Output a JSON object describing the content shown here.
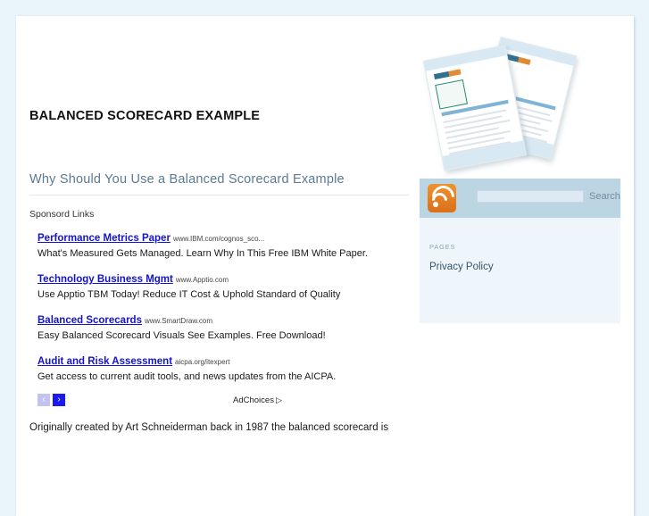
{
  "site": {
    "title": "BALANCED SCORECARD EXAMPLE"
  },
  "colors": {
    "page_background": "#eaf4fb",
    "card_background": "#ffffff",
    "heading": "#5c7a93",
    "ad_link": "#1414cc",
    "sidebar_header": "#bcd5e2",
    "sidebar_body": "#eef6fb",
    "rss_orange": "#e08a33",
    "pager_active": "#1a1aee",
    "pager_disabled": "#c3c3f0"
  },
  "header": {
    "art_name": "documents-illustration"
  },
  "main": {
    "post_title": "Why Should You Use a Balanced Scorecard Example",
    "ads": {
      "label": "Sponsord Links",
      "items": [
        {
          "headline": "Performance Metrics Paper",
          "url": "www.IBM.com/cognos_sco...",
          "description": "What's Measured Gets Managed. Learn Why In This Free IBM White Paper."
        },
        {
          "headline": "Technology Business Mgmt",
          "url": "www.Apptio.com",
          "description": "Use Apptio TBM Today! Reduce IT Cost & Uphold Standard of Quality"
        },
        {
          "headline": "Balanced Scorecards",
          "url": "www.SmartDraw.com",
          "description": "Easy Balanced Scorecard Visuals See Examples. Free Download!"
        },
        {
          "headline": "Audit and Risk Assessment",
          "url": "aicpa.org/itexpert",
          "description": "Get access to current audit tools, and news updates from the AICPA."
        }
      ],
      "pager_prev": "‹",
      "pager_next": "›",
      "adchoices_label": "AdChoices",
      "adchoices_icon": "▷"
    },
    "post_body": "Originally created by Art Schneiderman back in 1987 the balanced scorecard is"
  },
  "sidebar": {
    "search_value": "",
    "search_placeholder": "",
    "search_label": "Search",
    "pages_label": "PAGES",
    "links": [
      {
        "label": "Privacy Policy"
      }
    ]
  }
}
